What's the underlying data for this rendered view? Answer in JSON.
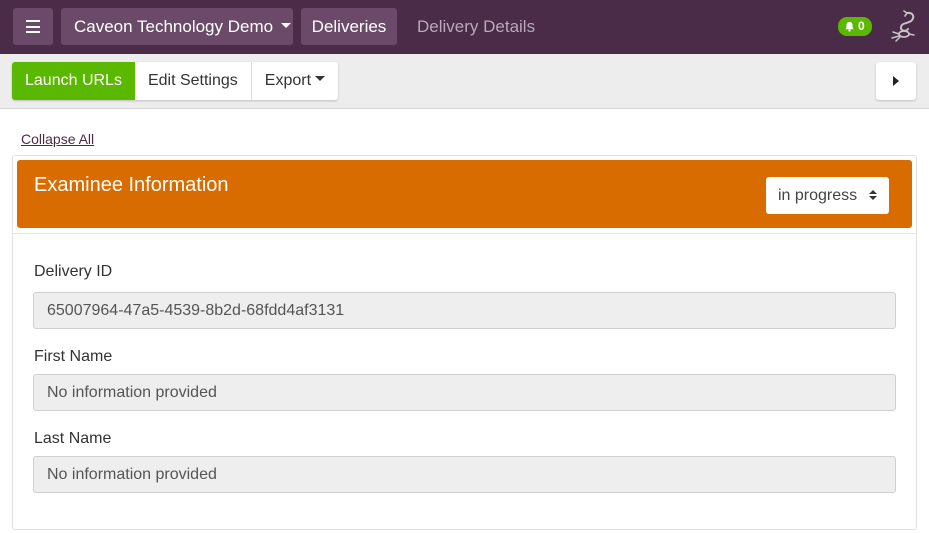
{
  "navbar": {
    "org_label": "Caveon Technology Demo",
    "deliveries_label": "Deliveries",
    "current_page": "Delivery Details",
    "notification_count": "0",
    "colors": {
      "bg": "#4a2b48",
      "button": "#6b4a69",
      "badge": "#5bb800"
    }
  },
  "toolbar": {
    "launch_label": "Launch URLs",
    "edit_label": "Edit Settings",
    "export_label": "Export"
  },
  "content": {
    "collapse_label": "Collapse All",
    "section": {
      "title": "Examinee Information",
      "status_value": "in progress",
      "header_color": "#d86c00"
    },
    "fields": [
      {
        "label": "Delivery ID",
        "value": "65007964-47a5-4539-8b2d-68fdd4af3131"
      },
      {
        "label": "First Name",
        "value": "No information provided"
      },
      {
        "label": "Last Name",
        "value": "No information provided"
      }
    ]
  }
}
